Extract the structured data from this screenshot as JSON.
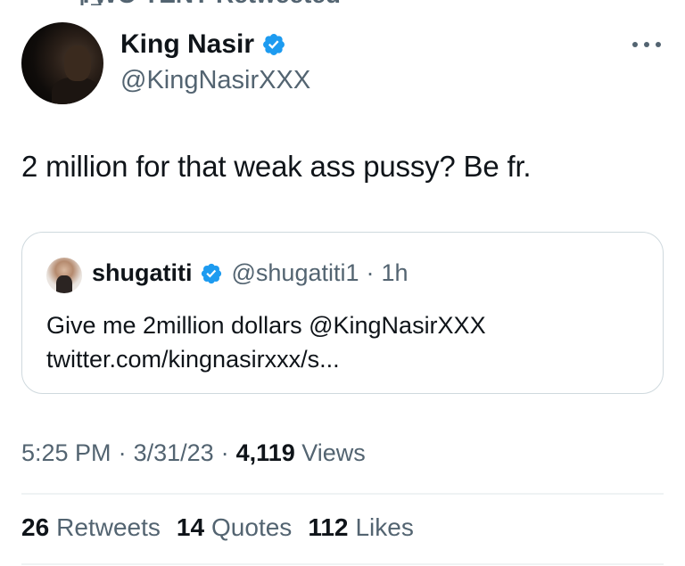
{
  "retweeted_by": "TWO TENT Retweeted",
  "author": {
    "name": "King Nasir",
    "handle": "@KingNasirXXX"
  },
  "tweet": {
    "text": "2 million for that weak ass pussy? Be fr."
  },
  "quoted": {
    "name": "shugatiti",
    "handle": "@shugatiti1",
    "separator": "·",
    "time": "1h",
    "line1": "Give me 2million dollars @KingNasirXXX",
    "line2": "twitter.com/kingnasirxxx/s..."
  },
  "meta": {
    "time": "5:25 PM",
    "separator": "·",
    "date": "3/31/23",
    "views_count": "4,119",
    "views_label": "Views"
  },
  "stats": [
    {
      "count": "26",
      "label": "Retweets"
    },
    {
      "count": "14",
      "label": "Quotes"
    },
    {
      "count": "112",
      "label": "Likes"
    }
  ],
  "icons": {
    "verified": "verified-badge-icon",
    "more": "more-icon",
    "retweet": "retweet-icon"
  },
  "colors": {
    "verified": "#1d9bf0",
    "secondary_text": "#536471",
    "primary_text": "#0f1419",
    "border": "#cfd9de"
  }
}
